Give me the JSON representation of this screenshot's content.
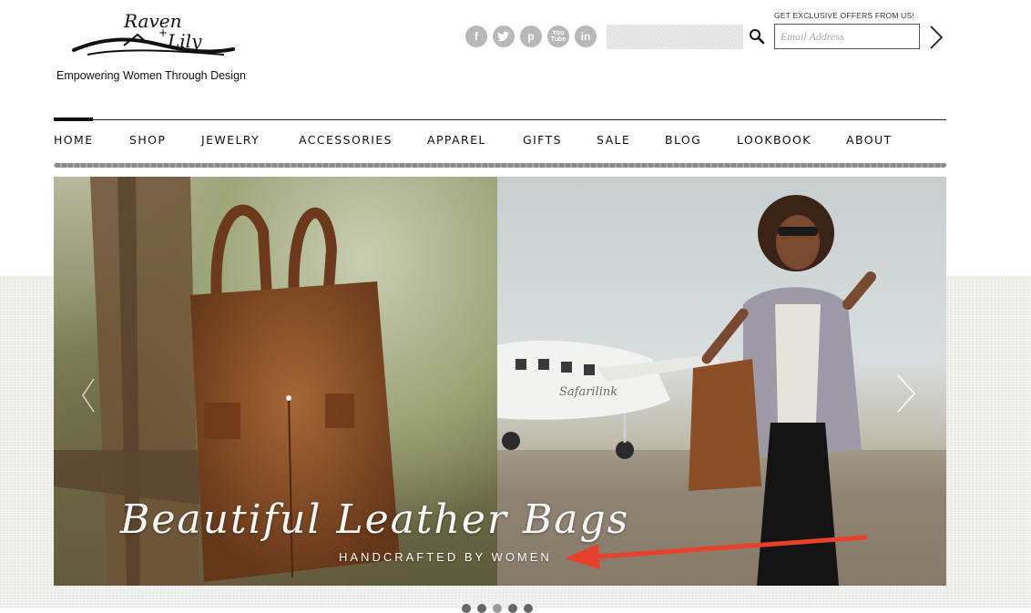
{
  "brand": {
    "logo_text": "Raven + Lily",
    "tagline": "Empowering Women Through Design"
  },
  "social": [
    {
      "icon": "facebook-icon",
      "glyph": "f"
    },
    {
      "icon": "twitter-icon",
      "glyph": "t"
    },
    {
      "icon": "pinterest-icon",
      "glyph": "p"
    },
    {
      "icon": "youtube-icon",
      "glyph": "You\nTube"
    },
    {
      "icon": "linkedin-icon",
      "glyph": "in"
    }
  ],
  "newsletter": {
    "label": "GET EXCLUSIVE OFFERS FROM US!",
    "placeholder": "Email Address"
  },
  "nav": {
    "items": [
      "HOME",
      "SHOP",
      "JEWELRY",
      "ACCESSORIES",
      "APPAREL",
      "GIFTS",
      "SALE",
      "BLOG",
      "LOOKBOOK",
      "ABOUT"
    ],
    "active": "HOME"
  },
  "hero": {
    "title": "Beautiful Leather Bags",
    "subtitle": "HANDCRAFTED BY WOMEN",
    "plane_text": "Safarilink",
    "slides_count": 5,
    "active_slide": 3
  },
  "colors": {
    "accent_arrow": "#e8412b",
    "icon_gray": "#b8b8b8"
  }
}
